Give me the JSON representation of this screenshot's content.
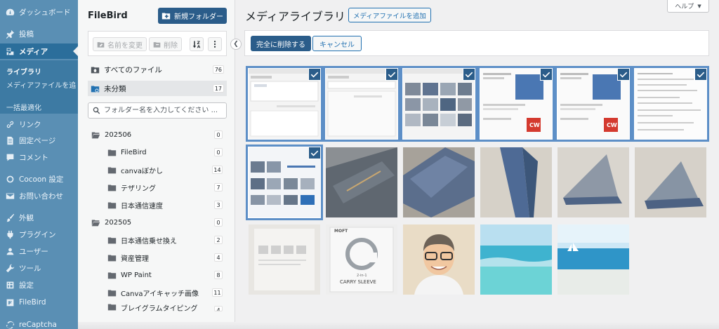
{
  "admin_menu": {
    "items": [
      {
        "label": "ダッシュボード",
        "icon": "dashboard-icon"
      },
      {
        "label": "投稿",
        "icon": "pin-icon"
      },
      {
        "label": "メディア",
        "icon": "media-icon"
      },
      {
        "label": "リンク",
        "icon": "link-icon"
      },
      {
        "label": "固定ページ",
        "icon": "page-icon"
      },
      {
        "label": "コメント",
        "icon": "comment-icon"
      },
      {
        "label": "Cocoon 設定",
        "icon": "circle-icon"
      },
      {
        "label": "お問い合わせ",
        "icon": "mail-icon"
      },
      {
        "label": "外観",
        "icon": "brush-icon"
      },
      {
        "label": "プラグイン",
        "icon": "plugin-icon"
      },
      {
        "label": "ユーザー",
        "icon": "user-icon"
      },
      {
        "label": "ツール",
        "icon": "wrench-icon"
      },
      {
        "label": "設定",
        "icon": "settings-icon"
      },
      {
        "label": "FileBird",
        "icon": "filebird-icon"
      },
      {
        "label": "reCaptcha",
        "icon": "recaptcha-icon"
      }
    ],
    "submenu": [
      "ライブラリ",
      "メディアファイルを追",
      "一括最適化"
    ]
  },
  "filebird": {
    "title": "FileBird",
    "new_folder": "新規フォルダー",
    "rename": "名前を変更",
    "delete": "削除",
    "sort_label": "1↓",
    "all_files": {
      "label": "すべてのファイル",
      "count": "76"
    },
    "uncategorized": {
      "label": "未分類",
      "count": "17"
    },
    "search_placeholder": "フォルダー名を入力してください ...",
    "tree": [
      {
        "label": "202506",
        "count": "0"
      },
      {
        "label": "FileBird",
        "count": "0"
      },
      {
        "label": "canvaぼかし",
        "count": "14"
      },
      {
        "label": "テザリング",
        "count": "7"
      },
      {
        "label": "日本通信速度",
        "count": "3"
      },
      {
        "label": "202505",
        "count": "0"
      },
      {
        "label": "日本通信乗せ換え",
        "count": "2"
      },
      {
        "label": "資産管理",
        "count": "4"
      },
      {
        "label": "WP Paint",
        "count": "8"
      },
      {
        "label": "Canvaアイキャッチ画像",
        "count": "11"
      },
      {
        "label": "ブレイグラムタイピング",
        "count": "4"
      }
    ]
  },
  "main": {
    "title": "メディアライブラリ",
    "add_media": "メディアファイルを追加",
    "help": "ヘルプ",
    "delete_permanently": "完全に削除する",
    "cancel": "キャンセル",
    "tile_texts": {
      "carry_sleeve": "CARRY SLEEVE",
      "moft": "MOFT",
      "sleeve_sub": "2-in-1",
      "cw": "CW"
    }
  },
  "colors": {
    "menu_bg": "#5a8fb4",
    "menu_active": "#2b6e9b",
    "primary": "#2b5d8a",
    "link": "#2271b1"
  }
}
